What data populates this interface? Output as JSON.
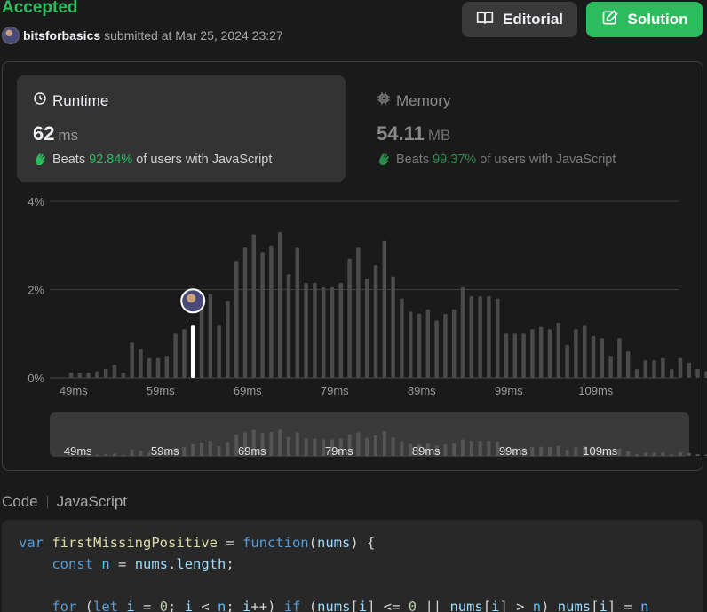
{
  "header": {
    "status": "Accepted",
    "username": "bitsforbasics",
    "submitted_text": "submitted at Mar 25, 2024 23:27",
    "editorial_label": "Editorial",
    "solution_label": "Solution"
  },
  "runtime": {
    "title": "Runtime",
    "value": "62",
    "unit": "ms",
    "beats_prefix": "Beats",
    "beats_pct": "92.84%",
    "beats_suffix": "of users with JavaScript"
  },
  "memory": {
    "title": "Memory",
    "value": "54.11",
    "unit": "MB",
    "beats_prefix": "Beats",
    "beats_pct": "99.37%",
    "beats_suffix": "of users with JavaScript"
  },
  "chart_data": {
    "type": "bar",
    "y_ticks": [
      "4%",
      "2%",
      "0%"
    ],
    "ylim": [
      0,
      4
    ],
    "x_tick_labels": [
      "49ms",
      "59ms",
      "69ms",
      "79ms",
      "89ms",
      "99ms",
      "109ms"
    ],
    "x_tick_values": [
      49,
      59,
      69,
      79,
      89,
      99,
      109
    ],
    "x_start": 48,
    "x_step": 1,
    "values": [
      0.12,
      0.12,
      0.12,
      0.15,
      0.2,
      0.3,
      0.12,
      0.8,
      0.65,
      0.45,
      0.45,
      0.5,
      1.0,
      1.1,
      1.45,
      1.65,
      1.9,
      1.2,
      1.75,
      2.65,
      2.95,
      3.25,
      2.85,
      3.0,
      3.3,
      2.35,
      2.95,
      2.15,
      2.15,
      2.05,
      2.05,
      2.15,
      2.7,
      2.95,
      2.25,
      2.55,
      3.1,
      2.3,
      1.8,
      1.5,
      1.45,
      1.55,
      1.3,
      1.45,
      1.55,
      2.05,
      1.85,
      1.85,
      1.85,
      1.8,
      1.0,
      1.0,
      1.0,
      1.1,
      1.15,
      1.1,
      1.25,
      0.75,
      1.1,
      1.2,
      0.95,
      0.9,
      0.5,
      0.9,
      0.6,
      0.2,
      0.4,
      0.4,
      0.45,
      0.2,
      0.45,
      0.35,
      0.2,
      0.15,
      0.45
    ],
    "highlight": {
      "x": 62,
      "value": 1.2
    }
  },
  "overview": {
    "labels": [
      "49ms",
      "59ms",
      "69ms",
      "79ms",
      "89ms",
      "99ms",
      "109ms"
    ]
  },
  "code": {
    "label": "Code",
    "language": "JavaScript",
    "lines": [
      "var firstMissingPositive = function(nums) {",
      "    const n = nums.length;",
      "",
      "    for (let i = 0; i < n; i++) if (nums[i] <= 0 || nums[i] > n) nums[i] = n"
    ]
  },
  "colors": {
    "accent_green": "#2cbb5d",
    "bar": "#4a4a4a",
    "highlight_bar": "#ffffff"
  }
}
